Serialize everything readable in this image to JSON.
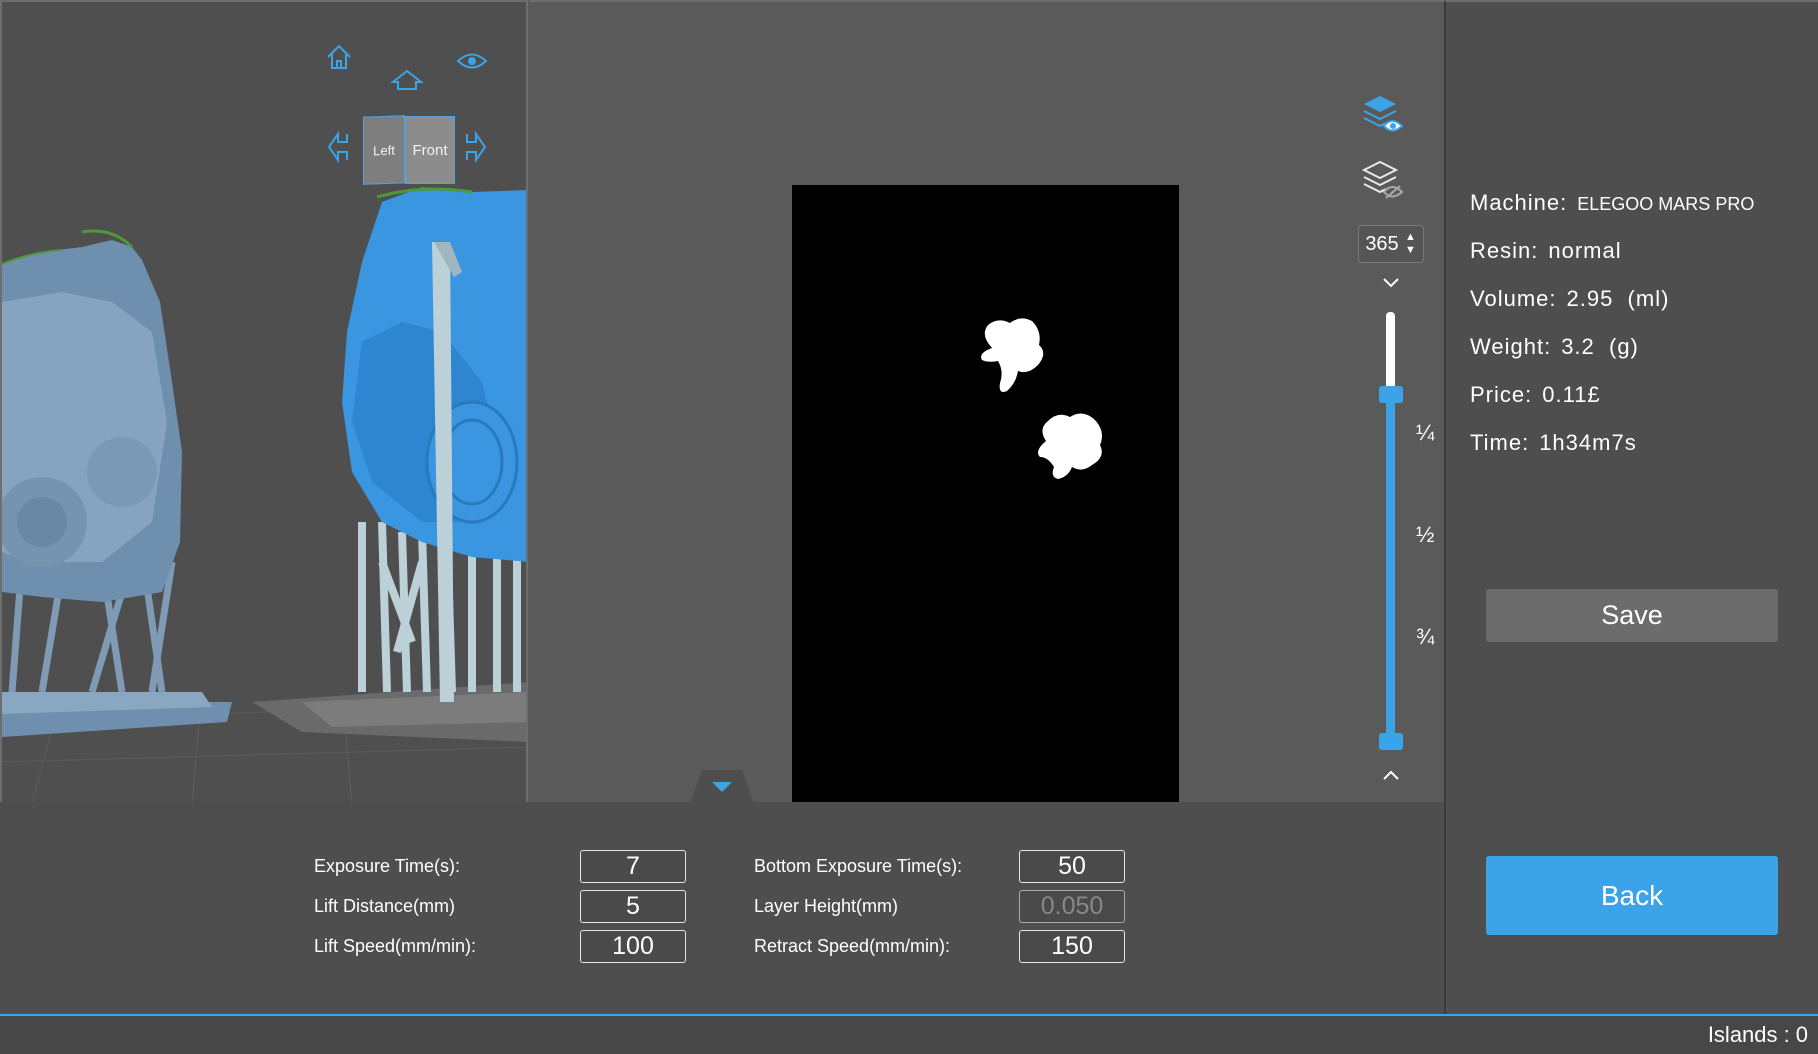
{
  "viewport": {
    "nav_icons": [
      "home-icon",
      "top-view-icon",
      "eye-icon",
      "rotate-left-icon",
      "rotate-right-icon"
    ],
    "cube": {
      "left_label": "Left",
      "front_label": "Front"
    }
  },
  "slice": {
    "layer_value": "365",
    "fraction_labels": [
      "¼",
      "½",
      "¾"
    ],
    "slider": {
      "top_position_fraction": 0.19,
      "bottom_position_fraction": 1.0
    },
    "icons": [
      "layers-show-icon",
      "layers-hide-icon"
    ]
  },
  "info": {
    "machine_label": "Machine:",
    "machine_value": "ELEGOO MARS PRO",
    "resin_label": "Resin:",
    "resin_value": "normal",
    "volume_label": "Volume:",
    "volume_value": "2.95  (ml)",
    "weight_label": "Weight:",
    "weight_value": "3.2  (g)",
    "price_label": "Price:",
    "price_value": "0.11£",
    "time_label": "Time:",
    "time_value": "1h34m7s",
    "save_label": "Save",
    "back_label": "Back"
  },
  "params": {
    "exposure_label": "Exposure Time(s):",
    "exposure_value": "7",
    "lift_distance_label": "Lift Distance(mm)",
    "lift_distance_value": "5",
    "lift_speed_label": "Lift Speed(mm/min):",
    "lift_speed_value": "100",
    "bottom_exposure_label": "Bottom Exposure Time(s):",
    "bottom_exposure_value": "50",
    "layer_height_label": "Layer Height(mm)",
    "layer_height_value": "0.050",
    "retract_speed_label": "Retract Speed(mm/min):",
    "retract_speed_value": "150"
  },
  "status": {
    "islands_label": "Islands :",
    "islands_value": "0"
  },
  "colors": {
    "accent": "#3ba4e8",
    "model_blue": "#3a96e0",
    "model_grey": "#6f8fae",
    "support": "#bcd0d8"
  }
}
